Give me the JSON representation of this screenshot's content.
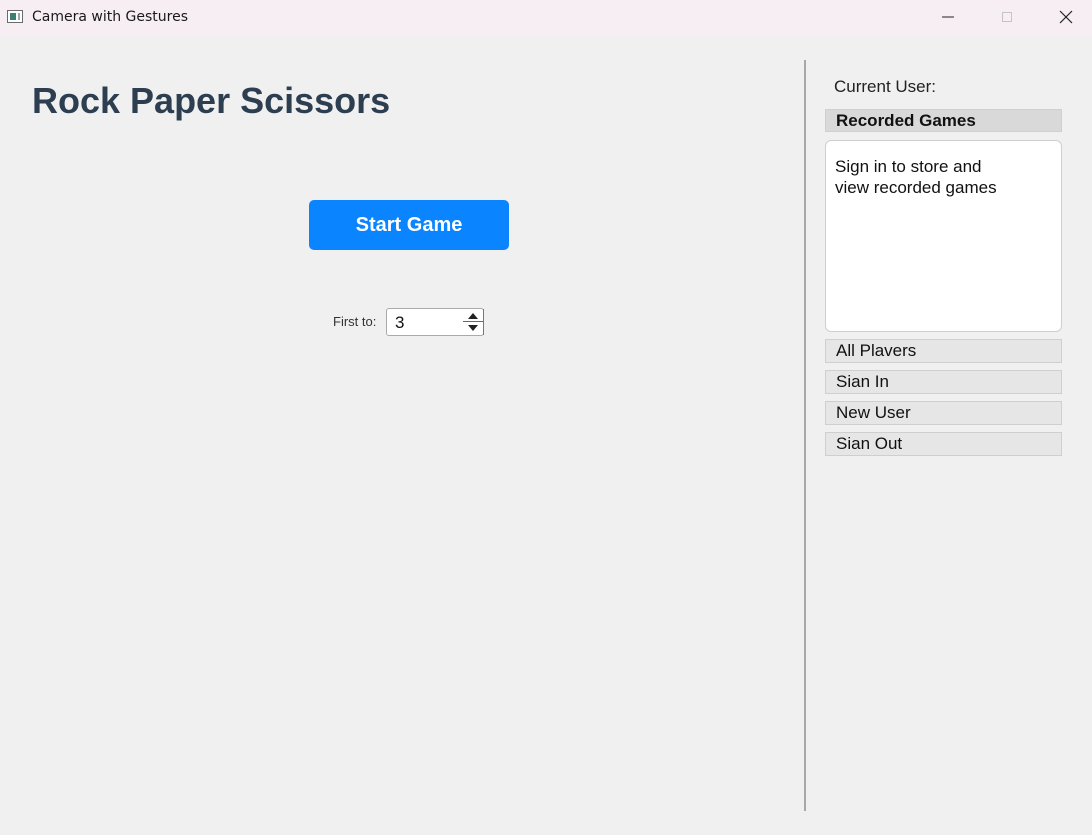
{
  "window": {
    "title": "Camera with Gestures"
  },
  "main": {
    "heading": "Rock Paper Scissors",
    "start_button": "Start Game",
    "first_to_label": "First to:",
    "first_to_value": "3"
  },
  "sidebar": {
    "current_user_label": "Current User:",
    "recorded_games_header": "Recorded Games",
    "recorded_games_message": "Sign in to store and\n view recorded games",
    "buttons": {
      "all_players": "All Plavers",
      "sign_in": "Sian In",
      "new_user": "New User",
      "sign_out": "Sian Out"
    }
  },
  "colors": {
    "accent": "#0a84ff",
    "heading": "#2c3e50",
    "background": "#f0f0f0"
  }
}
